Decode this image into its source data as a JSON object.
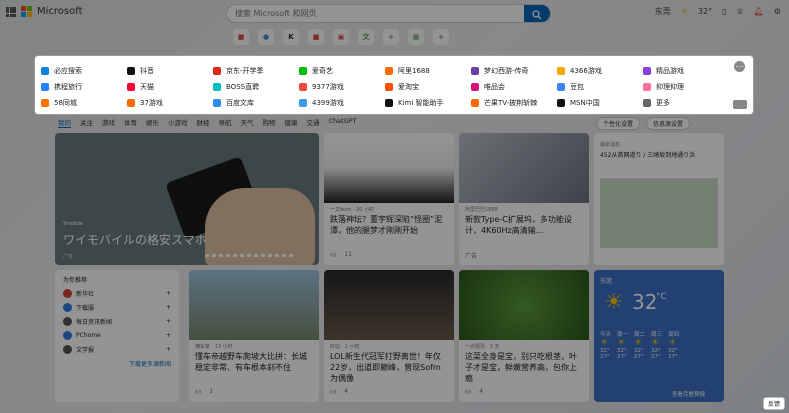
{
  "header": {
    "brand": "Microsoft",
    "search_placeholder": "搜索 Microsoft 和网页",
    "location": "东莞",
    "temperature": "32°"
  },
  "quick_links": [
    {
      "label": "",
      "color": "#e34a3c"
    },
    {
      "label": "",
      "color": "#4a8be0"
    },
    {
      "label": "",
      "color": "#222222"
    },
    {
      "label": "",
      "color": "#e34a3c"
    },
    {
      "label": "",
      "color": "#e34a3c"
    },
    {
      "label": "",
      "color": "#4aa04a"
    },
    {
      "label": "",
      "color": "#888888"
    },
    {
      "label": "",
      "color": "#4aa04a"
    },
    {
      "label": "",
      "color": "#888888"
    }
  ],
  "panel": {
    "links": [
      {
        "label": "必应搜索",
        "color": "#0f7fe0"
      },
      {
        "label": "抖音",
        "color": "#111111"
      },
      {
        "label": "京东-开学季",
        "color": "#e1251b"
      },
      {
        "label": "爱奇艺",
        "color": "#00be06"
      },
      {
        "label": "阿里1688",
        "color": "#ff6a00"
      },
      {
        "label": "梦幻西游-传奇",
        "color": "#6b3fa0"
      },
      {
        "label": "4366游戏",
        "color": "#f2a900"
      },
      {
        "label": "精品游戏",
        "color": "#8a3fe0"
      },
      {
        "label": "携程旅行",
        "color": "#2681ff"
      },
      {
        "label": "天猫",
        "color": "#ff0036"
      },
      {
        "label": "BOSS直聘",
        "color": "#00bebd"
      },
      {
        "label": "9377游戏",
        "color": "#e94b3c"
      },
      {
        "label": "爱淘宝",
        "color": "#ff5000"
      },
      {
        "label": "唯品会",
        "color": "#d6127b"
      },
      {
        "label": "豆包",
        "color": "#3b82f6"
      },
      {
        "label": "抑理抑理",
        "color": "#fb7299"
      },
      {
        "label": "58同城",
        "color": "#ff7300"
      },
      {
        "label": "37游戏",
        "color": "#ff6a00"
      },
      {
        "label": "百度文库",
        "color": "#2d8cf0"
      },
      {
        "label": "4399游戏",
        "color": "#3a9be8"
      },
      {
        "label": "Kimi 智能助手",
        "color": "#111111"
      },
      {
        "label": "芒果TV-披荆斩棘",
        "color": "#ff6a00"
      },
      {
        "label": "MSN中国",
        "color": "#111111"
      },
      {
        "label": "更多",
        "color": "#666666"
      }
    ]
  },
  "nav": {
    "tabs": [
      "我的",
      "关注",
      "游戏",
      "体育",
      "娱乐",
      "小游戏",
      "财经",
      "导航",
      "天气",
      "购物",
      "健康",
      "交通",
      "ChatGPT"
    ],
    "personalize": "个性化设置",
    "feed_settings": "信息源设置"
  },
  "hero": {
    "source": "Ymobile",
    "title": "ワイモバイルの格安スマホ",
    "ad": "广告"
  },
  "cards": [
    {
      "source": "一文boot · 20 小时",
      "title": "跌落神坛？董宇辉深陷“怪圈”泥潭，他的腿梦才刚刚开始",
      "likes": "11"
    },
    {
      "source": "阿里巴巴1688",
      "title": "新款Type-C扩展坞，多功能设计，4K60Hz高清输...",
      "likes": "广告"
    },
    {
      "source": "懂车家 · 13 小时",
      "title": "懂车帝越野车爬坡大比拼：长城稳定非常、有车根本刹不住",
      "likes": "1"
    },
    {
      "source": "好站 · 1 小时",
      "title": "LOL新生代冠军打野离世！年仅22岁，出道即巅峰，曾现Sofm为偶像",
      "likes": "4"
    },
    {
      "source": "一点视讯 · 1 天",
      "title": "这菜全身是宝，别只吃根茎，叶子才是宝，鲜嫩营养高，包你上瘾",
      "likes": "4"
    }
  ],
  "map_card": {
    "title": "最新消息",
    "text": "452从首网道り / 三崎坂到地通り浜"
  },
  "weather": {
    "location": "东莞",
    "temp": "32",
    "unit": "°C",
    "days": [
      {
        "label": "今天",
        "high": "32°",
        "low": "27°"
      },
      {
        "label": "周一",
        "high": "32°",
        "low": "27°"
      },
      {
        "label": "周二",
        "high": "32°",
        "low": "27°"
      },
      {
        "label": "周三",
        "high": "32°",
        "low": "27°"
      },
      {
        "label": "周四",
        "high": "32°",
        "low": "27°"
      }
    ],
    "more": "查看完整预报"
  },
  "sidebar": {
    "title": "为你推荐",
    "items": [
      {
        "label": "新华社",
        "color": "#d43c3c"
      },
      {
        "label": "下载服",
        "color": "#2f7be4"
      },
      {
        "label": "每日资讯新闻",
        "color": "#555555"
      },
      {
        "label": "PChome",
        "color": "#2f7be4"
      },
      {
        "label": "文学报",
        "color": "#555555"
      }
    ],
    "more": "下载更多源新闻"
  },
  "feedback": "反馈"
}
